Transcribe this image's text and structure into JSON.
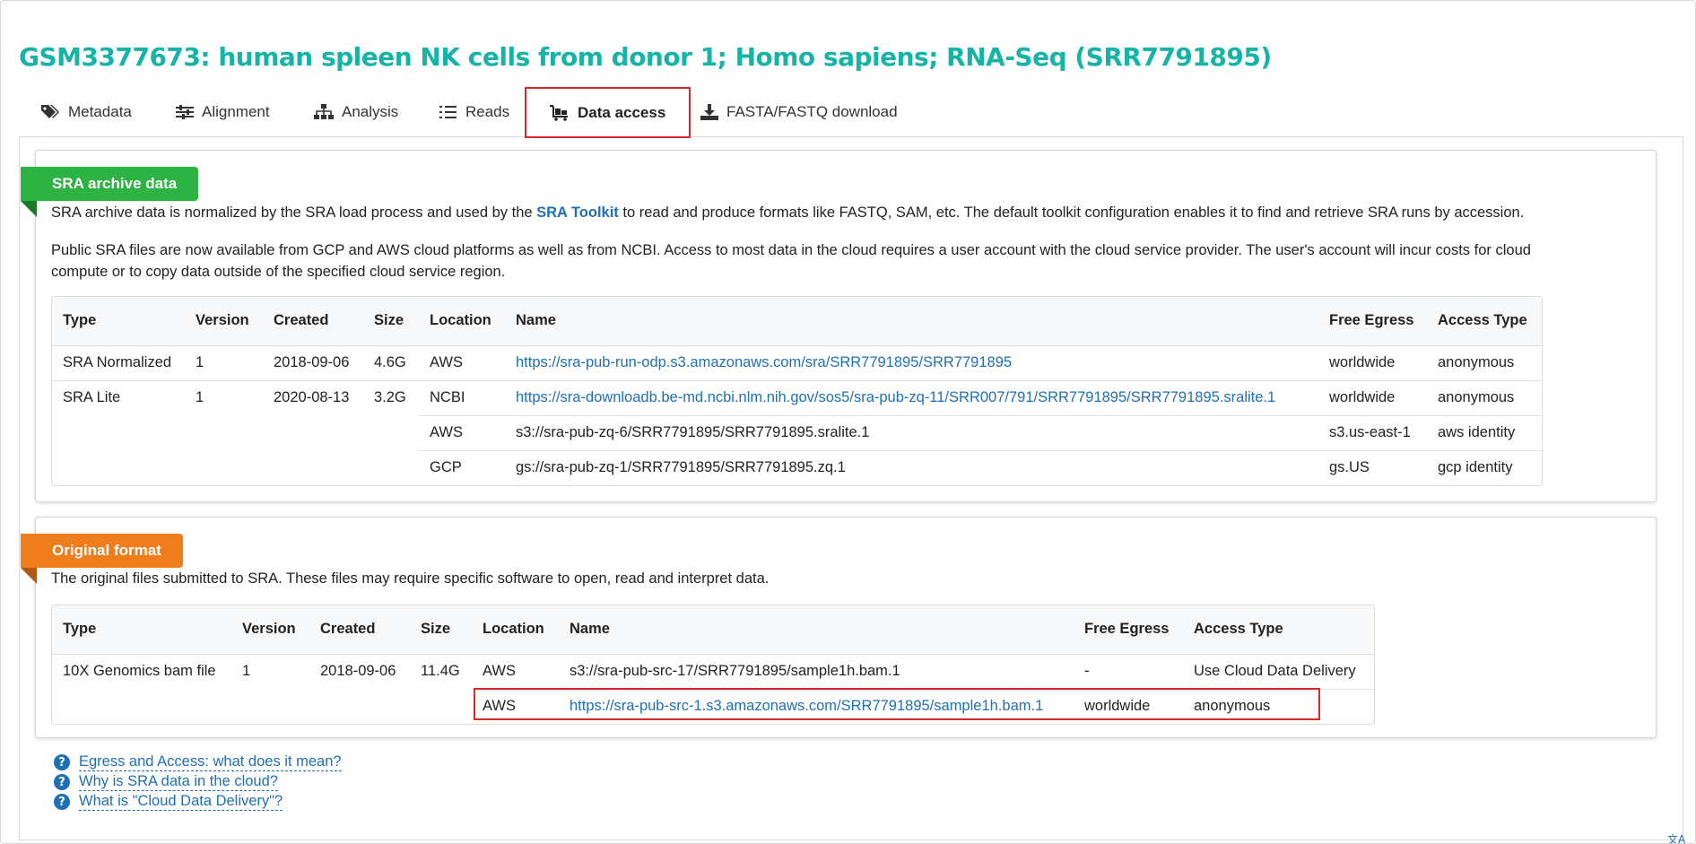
{
  "page_title": "GSM3377673: human spleen NK cells from donor 1; Homo sapiens; RNA-Seq (SRR7791895)",
  "tabs": [
    {
      "label": "Metadata",
      "icon": "tags-icon"
    },
    {
      "label": "Alignment",
      "icon": "sliders-icon"
    },
    {
      "label": "Analysis",
      "icon": "sitemap-icon"
    },
    {
      "label": "Reads",
      "icon": "list-icon"
    },
    {
      "label": "Data access",
      "icon": "cart-icon",
      "active": true
    },
    {
      "label": "FASTA/FASTQ download",
      "icon": "download-icon"
    }
  ],
  "sra_archive": {
    "ribbon": "SRA archive data",
    "p1_before": "SRA archive data is normalized by the SRA load process and used by the ",
    "p1_link": "SRA Toolkit",
    "p1_after": " to read and produce formats like FASTQ, SAM, etc. The default toolkit configuration enables it to find and retrieve SRA runs by accession.",
    "p2_line1": "Public SRA files are now available from GCP and AWS cloud platforms as well as from NCBI. Access to most data in the cloud requires a user account with the cloud service provider. The user's account will incur costs for cloud",
    "p2_line2": "compute or to copy data outside of the specified cloud service region.",
    "headers": [
      "Type",
      "Version",
      "Created",
      "Size",
      "Location",
      "Name",
      "Free Egress",
      "Access Type"
    ],
    "rows": [
      {
        "type": "SRA Normalized",
        "version": "1",
        "created": "2018-09-06",
        "size": "4.6G",
        "location": "AWS",
        "name": "https://sra-pub-run-odp.s3.amazonaws.com/sra/SRR7791895/SRR7791895",
        "name_is_link": true,
        "egress": "worldwide",
        "access": "anonymous"
      },
      {
        "type": "SRA Lite",
        "version": "1",
        "created": "2020-08-13",
        "size": "3.2G",
        "location": "NCBI",
        "name": "https://sra-downloadb.be-md.ncbi.nlm.nih.gov/sos5/sra-pub-zq-11/SRR007/791/SRR7791895/SRR7791895.sralite.1",
        "name_is_link": true,
        "egress": "worldwide",
        "access": "anonymous"
      },
      {
        "type": "",
        "version": "",
        "created": "",
        "size": "",
        "location": "AWS",
        "name": "s3://sra-pub-zq-6/SRR7791895/SRR7791895.sralite.1",
        "name_is_link": false,
        "egress": "s3.us-east-1",
        "access": "aws identity"
      },
      {
        "type": "",
        "version": "",
        "created": "",
        "size": "",
        "location": "GCP",
        "name": "gs://sra-pub-zq-1/SRR7791895/SRR7791895.zq.1",
        "name_is_link": false,
        "egress": "gs.US",
        "access": "gcp identity"
      }
    ]
  },
  "original_format": {
    "ribbon": "Original format",
    "p1": "The original files submitted to SRA. These files may require specific software to open, read and interpret data.",
    "headers": [
      "Type",
      "Version",
      "Created",
      "Size",
      "Location",
      "Name",
      "Free Egress",
      "Access Type"
    ],
    "rows": [
      {
        "type": "10X Genomics bam file",
        "version": "1",
        "created": "2018-09-06",
        "size": "11.4G",
        "location": "AWS",
        "name": "s3://sra-pub-src-17/SRR7791895/sample1h.bam.1",
        "name_is_link": false,
        "egress": "-",
        "access": "Use Cloud Data Delivery"
      },
      {
        "type": "",
        "version": "",
        "created": "",
        "size": "",
        "location": "AWS",
        "name": "https://sra-pub-src-1.s3.amazonaws.com/SRR7791895/sample1h.bam.1",
        "name_is_link": true,
        "egress": "worldwide",
        "access": "anonymous"
      }
    ]
  },
  "help_links": [
    "Egress and Access: what does it mean?",
    "Why is SRA data in the cloud?",
    "What is \"Cloud Data Delivery\"?"
  ],
  "colors": {
    "title": "#16b3a6",
    "link": "#1f6fb5",
    "highlight": "#d9262d",
    "ribbon_green": "#2db343",
    "ribbon_orange": "#f07d1c"
  }
}
